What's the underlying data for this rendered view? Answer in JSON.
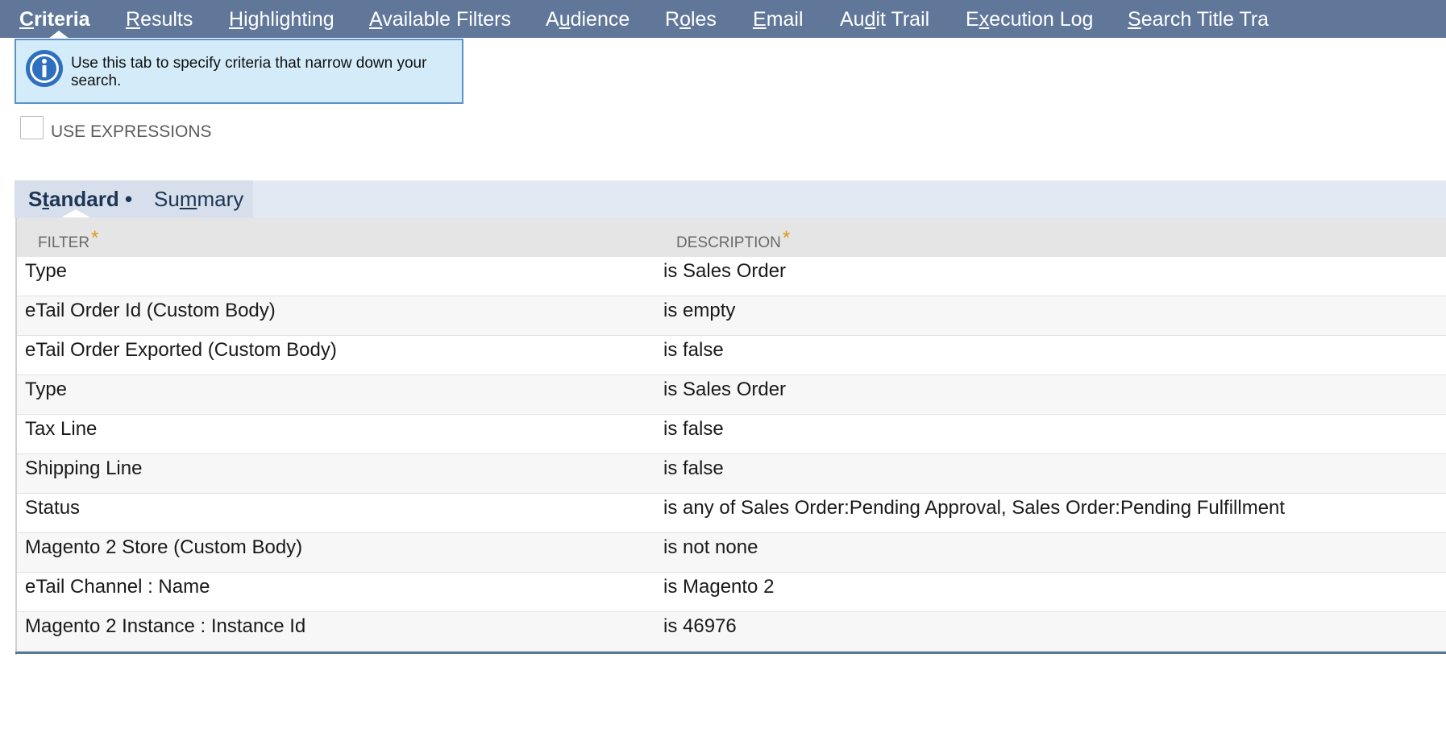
{
  "nav": {
    "tabs": [
      {
        "pre": "",
        "ul": "C",
        "post": "riteria",
        "active": true
      },
      {
        "pre": "",
        "ul": "R",
        "post": "esults"
      },
      {
        "pre": "",
        "ul": "H",
        "post": "ighlighting"
      },
      {
        "pre": "",
        "ul": "A",
        "post": "vailable Filters"
      },
      {
        "pre": "A",
        "ul": "u",
        "post": "dience"
      },
      {
        "pre": "R",
        "ul": "o",
        "post": "les"
      },
      {
        "pre": "",
        "ul": "E",
        "post": "mail"
      },
      {
        "pre": "Au",
        "ul": "d",
        "post": "it Trail"
      },
      {
        "pre": "E",
        "ul": "x",
        "post": "ecution Log"
      },
      {
        "pre": "",
        "ul": "S",
        "post": "earch Title Tra"
      }
    ]
  },
  "info": {
    "icon": "info-icon",
    "message": "Use this tab to specify criteria that narrow down your search."
  },
  "use_expressions": {
    "label": "USE EXPRESSIONS",
    "checked": false
  },
  "subtabs": {
    "standard": {
      "pre": "S",
      "ul": "t",
      "post": "andard",
      "dot": "•"
    },
    "summary": {
      "pre": "Su",
      "ul": "m",
      "post": "mary"
    }
  },
  "table": {
    "headers": {
      "filter": "FILTER",
      "description": "DESCRIPTION",
      "required_mark": "*"
    },
    "rows": [
      {
        "filter": "Type",
        "description": "is Sales Order"
      },
      {
        "filter": "eTail Order Id (Custom Body)",
        "description": "is empty"
      },
      {
        "filter": "eTail Order Exported (Custom Body)",
        "description": "is false"
      },
      {
        "filter": "Type",
        "description": "is Sales Order"
      },
      {
        "filter": "Tax Line",
        "description": "is false"
      },
      {
        "filter": "Shipping Line",
        "description": "is false"
      },
      {
        "filter": "Status",
        "description": "is any of Sales Order:Pending Approval, Sales Order:Pending Fulfillment"
      },
      {
        "filter": "Magento 2 Store (Custom Body)",
        "description": "is not none"
      },
      {
        "filter": "eTail Channel : Name",
        "description": "is Magento 2"
      },
      {
        "filter": "Magento 2 Instance : Instance Id",
        "description": "is 46976"
      }
    ]
  },
  "colors": {
    "nav_bg": "#607799",
    "info_bg": "#d4ecf9",
    "info_border": "#5a92c9",
    "subtab_bg": "#e3e9f2",
    "required_star": "#e09620"
  }
}
